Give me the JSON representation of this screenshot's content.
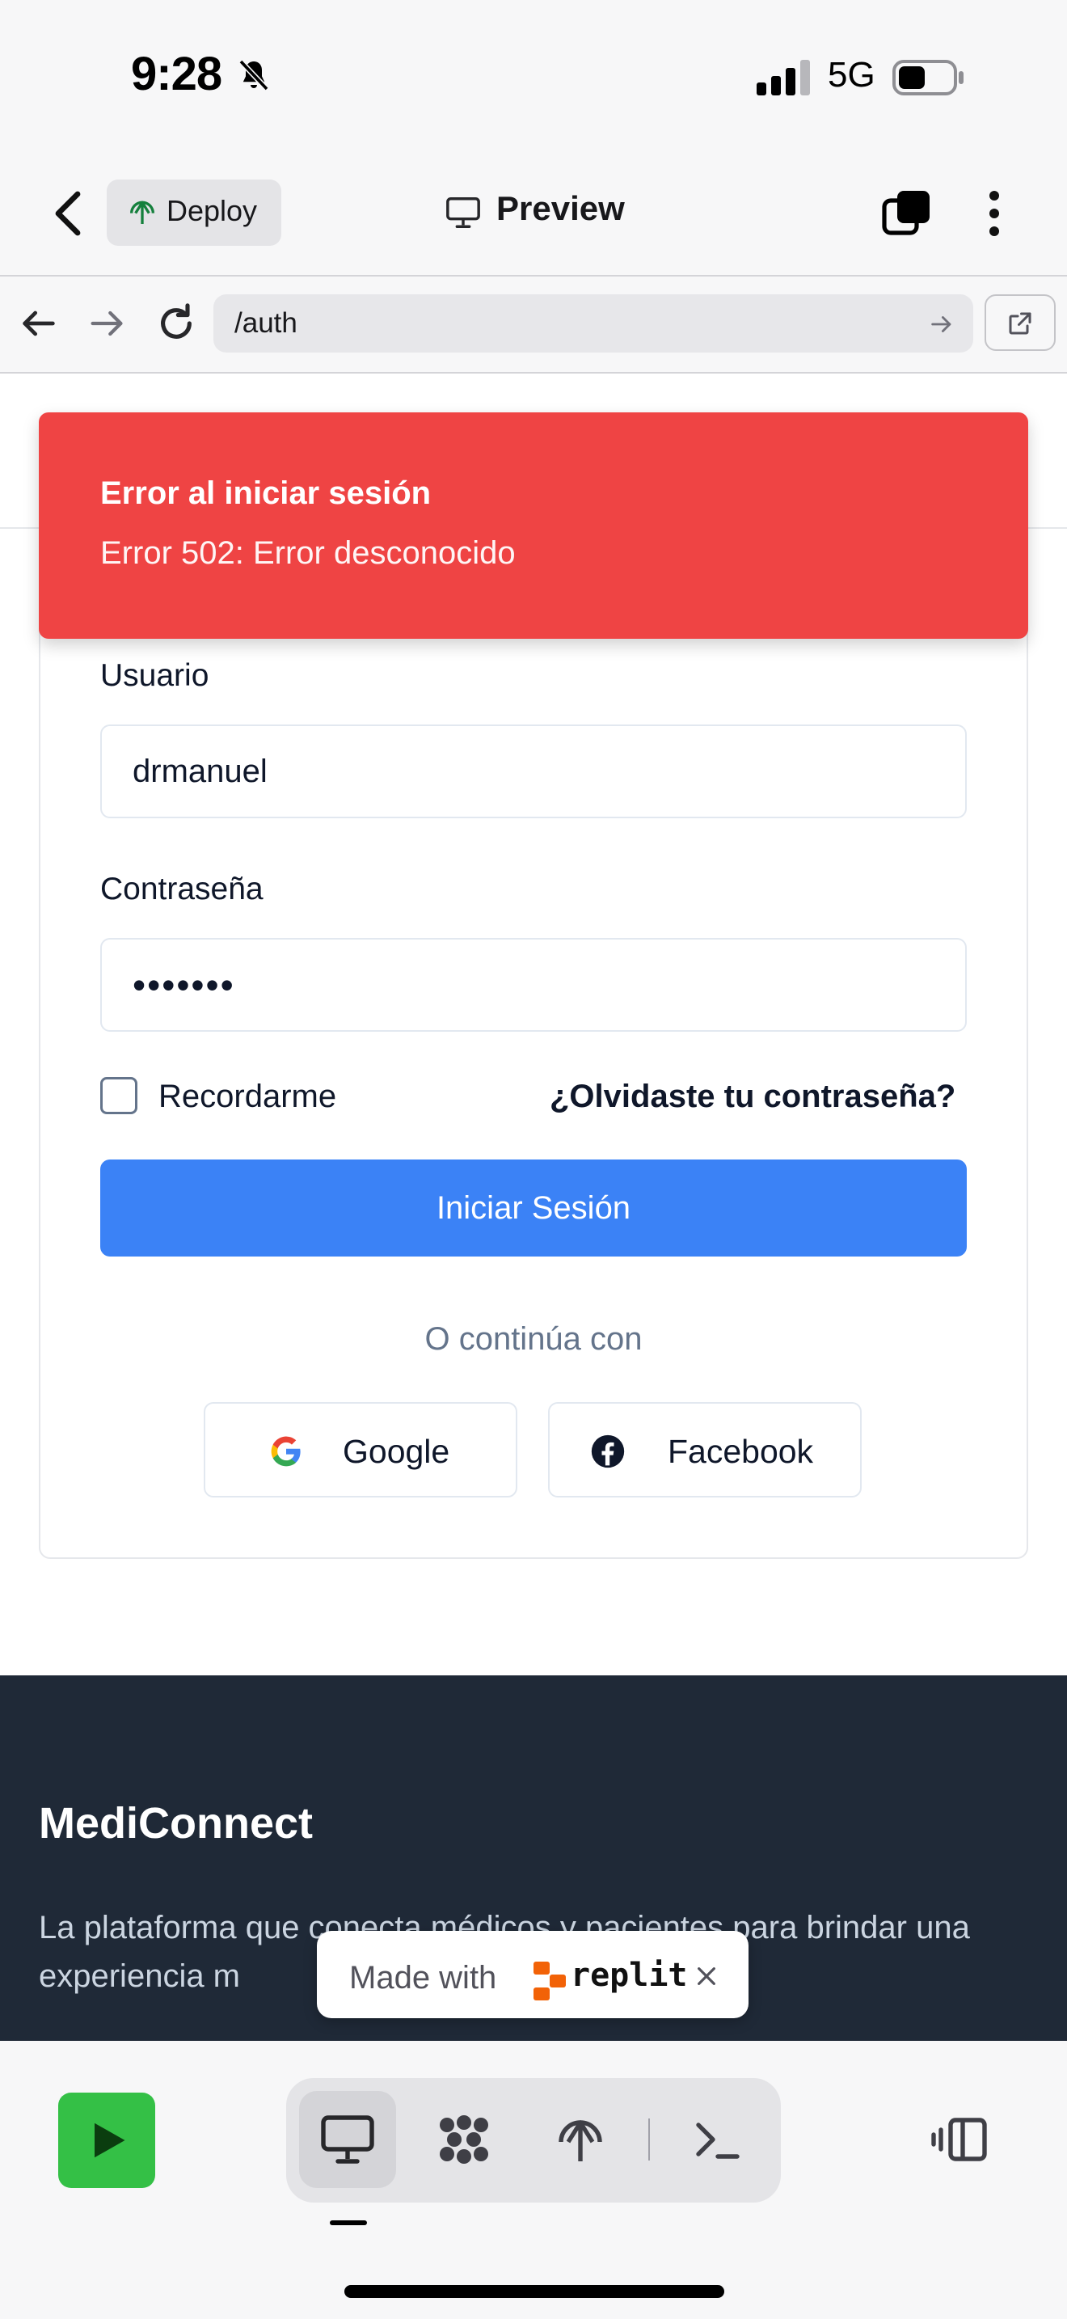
{
  "status_bar": {
    "time": "9:28",
    "network": "5G"
  },
  "header": {
    "deploy_label": "Deploy",
    "preview_label": "Preview"
  },
  "browser": {
    "url": "/auth"
  },
  "toast": {
    "title": "Error al iniciar sesión",
    "description": "Error 502: Error desconocido"
  },
  "login_form": {
    "username_label": "Usuario",
    "username_value": "drmanuel",
    "password_label": "Contraseña",
    "password_value": "•••••••",
    "remember_label": "Recordarme",
    "remember_checked": false,
    "forgot_label": "¿Olvidaste tu contraseña?",
    "submit_label": "Iniciar Sesión",
    "divider_text": "O continúa con",
    "google_label": "Google",
    "facebook_label": "Facebook"
  },
  "footer": {
    "brand": "MediConnect",
    "description": "La plataforma que conecta médicos y pacientes para brindar una experiencia m                                   da."
  },
  "badge": {
    "made_with": "Made with",
    "brand": "replit"
  },
  "colors": {
    "primary": "#3b82f6",
    "error": "#ef4444",
    "footer_bg": "#1f2937",
    "run_green": "#34c046"
  }
}
